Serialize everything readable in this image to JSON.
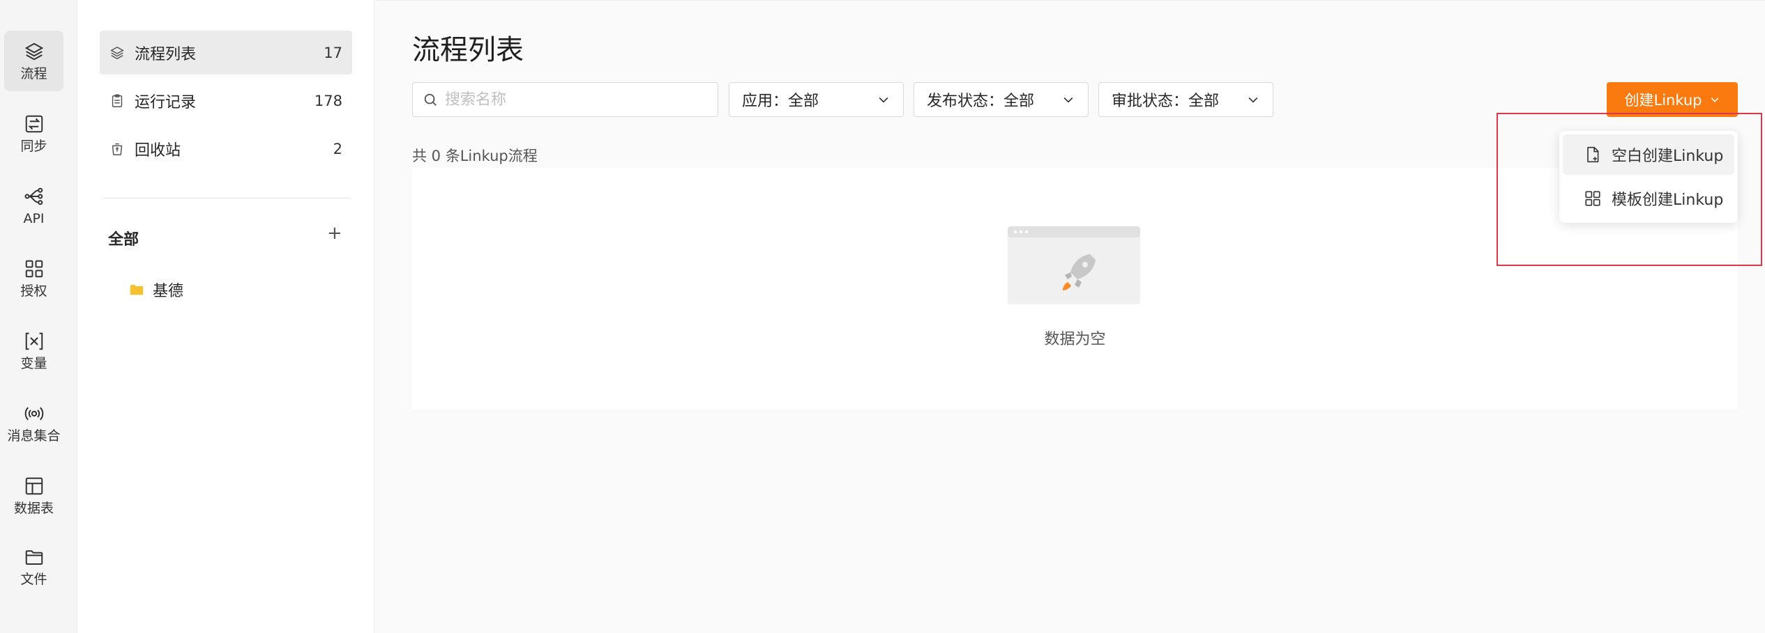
{
  "rail": {
    "items": [
      {
        "label": "流程",
        "icon": "layers-icon"
      },
      {
        "label": "同步",
        "icon": "sync-icon"
      },
      {
        "label": "API",
        "icon": "api-icon"
      },
      {
        "label": "授权",
        "icon": "grid-icon"
      },
      {
        "label": "变量",
        "icon": "variable-icon"
      },
      {
        "label": "消息集合",
        "icon": "broadcast-icon"
      },
      {
        "label": "数据表",
        "icon": "table-icon"
      },
      {
        "label": "文件",
        "icon": "folder-icon"
      }
    ]
  },
  "sidebar": {
    "items": [
      {
        "label": "流程列表",
        "count": "17",
        "icon": "layers-icon"
      },
      {
        "label": "运行记录",
        "count": "178",
        "icon": "clipboard-icon"
      },
      {
        "label": "回收站",
        "count": "2",
        "icon": "recycle-bin-icon"
      }
    ],
    "group_title": "全部",
    "group_add": "+",
    "folders": [
      {
        "label": "基德",
        "color": "#f5c12e"
      }
    ]
  },
  "main": {
    "title": "流程列表",
    "search_placeholder": "搜索名称",
    "filters": [
      {
        "label": "应用：全部"
      },
      {
        "label": "发布状态：全部"
      },
      {
        "label": "审批状态：全部"
      }
    ],
    "create_button": "创建Linkup",
    "count_text": "共 0 条Linkup流程",
    "empty_text": "数据为空"
  },
  "dropdown": {
    "items": [
      {
        "label": "空白创建Linkup",
        "icon": "blank-file-icon"
      },
      {
        "label": "模板创建Linkup",
        "icon": "template-grid-icon"
      }
    ]
  },
  "colors": {
    "accent": "#fa7a0f",
    "highlight": "#e0364a",
    "folder": "#f5c12e"
  }
}
